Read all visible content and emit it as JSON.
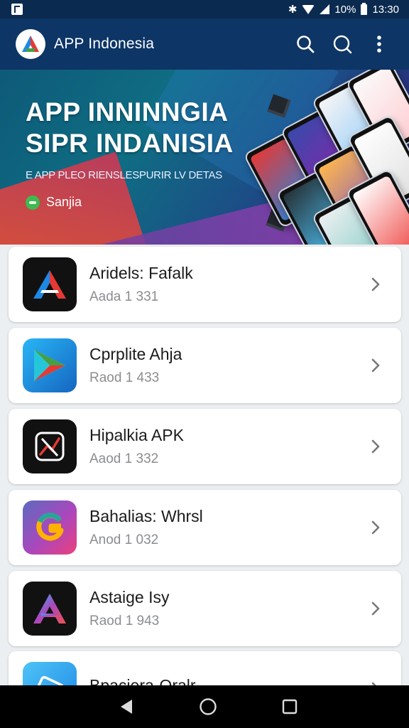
{
  "status_bar": {
    "battery": "10%",
    "time": "13:30",
    "icons": [
      "notification-icon",
      "bluetooth-icon",
      "wifi-icon",
      "signal-icon",
      "battery-icon"
    ]
  },
  "app_bar": {
    "title": "APP Indonesia",
    "actions": [
      "search-icon",
      "search-icon",
      "more-vert-icon"
    ]
  },
  "banner": {
    "title_line1": "APP INNINNGIA",
    "title_line2": "SIPR INDANISIA",
    "subtitle": "E APP PLEO RIENSLESPURIR LV DETAS",
    "badge_label": "Sanjia"
  },
  "apps": [
    {
      "name": "Aridels: Fafalk",
      "meta": "Aada 1 331",
      "icon": "a-logo-red-blue"
    },
    {
      "name": "Cprplite Ahja",
      "meta": "Raod 1 433",
      "icon": "play-triangle"
    },
    {
      "name": "Hipalkia APK",
      "meta": "Aaod 1 332",
      "icon": "x-chart-logo"
    },
    {
      "name": "Bahalias: Whrsl",
      "meta": "Anod 1 032",
      "icon": "g-gradient-logo"
    },
    {
      "name": "Astaige Isy",
      "meta": "Raod 1 943",
      "icon": "a-logo-gradient"
    },
    {
      "name": "Bpaciera-Oralr",
      "meta": "",
      "icon": "blue-card-logo"
    }
  ],
  "colors": {
    "app_bar": "#0d3566",
    "status_bar": "#0b2a4f",
    "background": "#eceff1"
  },
  "nav_bar": [
    "back-icon",
    "home-icon",
    "recents-icon"
  ]
}
